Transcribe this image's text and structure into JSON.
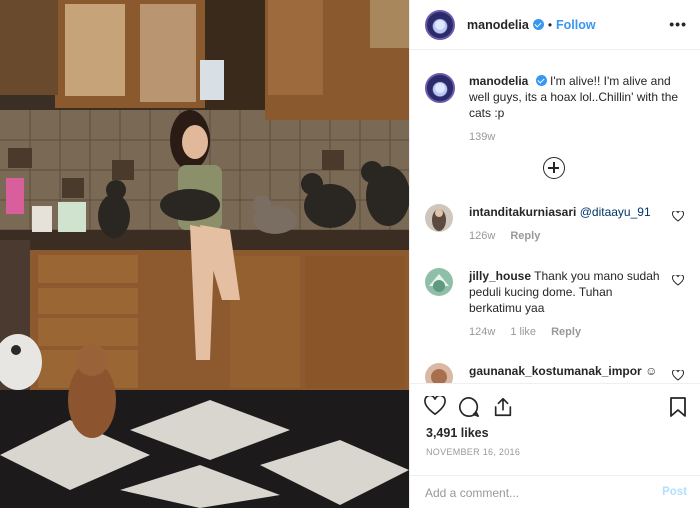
{
  "post": {
    "username": "manodelia",
    "follow_label": "Follow",
    "more_icon": "•••",
    "caption": "I'm alive!! I'm alive and well guys, its a hoax lol..Chillin' with the cats :p",
    "caption_time": "139w",
    "load_more_icon": "plus-circle-icon"
  },
  "comments": [
    {
      "username": "intanditakurniasari",
      "text": "@ditaayu_91",
      "time": "126w",
      "likes": "",
      "reply": "Reply"
    },
    {
      "username": "jilly_house",
      "text": "Thank you mano sudah peduli kucing dome. Tuhan berkatimu yaa",
      "time": "124w",
      "likes": "1 like",
      "reply": "Reply"
    },
    {
      "username": "gaunanak_kostumanak_impor",
      "text": "☺",
      "time": "",
      "likes": "",
      "reply": ""
    }
  ],
  "actions": {
    "likes": "3,491 likes",
    "date": "NOVEMBER 16, 2016",
    "add_comment_placeholder": "Add a comment...",
    "post_label": "Post"
  },
  "colors": {
    "link_blue": "#3897f0",
    "muted": "#999999",
    "post_disabled": "#b2dffc"
  }
}
